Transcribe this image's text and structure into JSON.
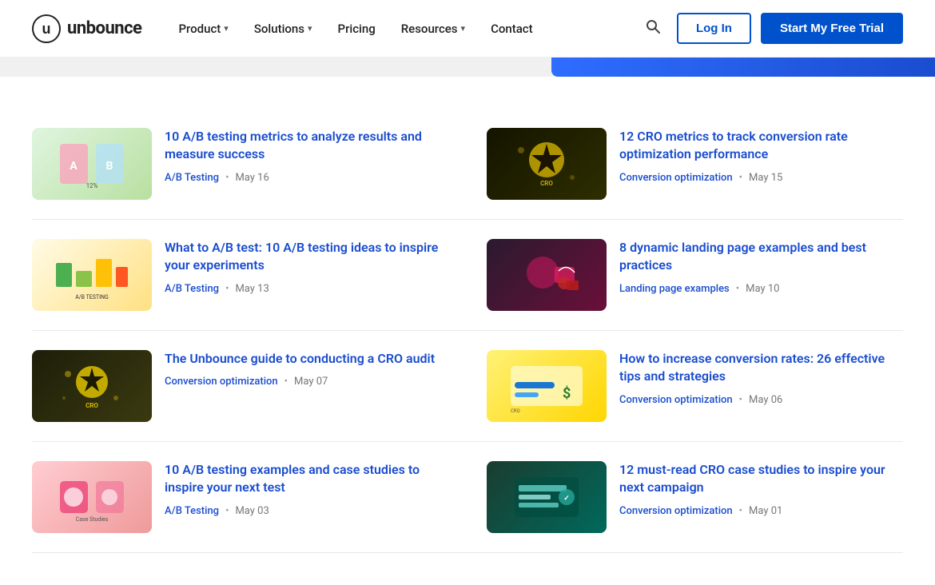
{
  "header": {
    "logo_text": "unbounce",
    "nav": [
      {
        "label": "Product",
        "has_dropdown": true
      },
      {
        "label": "Solutions",
        "has_dropdown": true
      },
      {
        "label": "Pricing",
        "has_dropdown": false
      },
      {
        "label": "Resources",
        "has_dropdown": true
      },
      {
        "label": "Contact",
        "has_dropdown": false
      }
    ],
    "login_label": "Log In",
    "trial_label": "Start My Free Trial"
  },
  "articles": [
    {
      "id": "ab-metrics",
      "title": "10 A/B testing metrics to analyze results and measure success",
      "category": "A/B Testing",
      "date": "May 16",
      "thumb_type": "ab-test-1",
      "col": "left"
    },
    {
      "id": "cro-metrics",
      "title": "12 CRO metrics to track conversion rate optimization performance",
      "category": "Conversion optimization",
      "date": "May 15",
      "thumb_type": "cro-metrics",
      "col": "right"
    },
    {
      "id": "ab-ideas",
      "title": "What to A/B test: 10 A/B testing ideas to inspire your experiments",
      "category": "A/B Testing",
      "date": "May 13",
      "thumb_type": "ab-test-2",
      "col": "left"
    },
    {
      "id": "landing-examples",
      "title": "8 dynamic landing page examples and best practices",
      "category": "Landing page examples",
      "date": "May 10",
      "thumb_type": "landing-page",
      "col": "right"
    },
    {
      "id": "cro-audit",
      "title": "The Unbounce guide to conducting a CRO audit",
      "category": "Conversion optimization",
      "date": "May 07",
      "thumb_type": "cro-guide",
      "col": "left"
    },
    {
      "id": "conversion-rates",
      "title": "How to increase conversion rates: 26 effective tips and strategies",
      "category": "Conversion optimization",
      "date": "May 06",
      "thumb_type": "conversion-rates",
      "col": "right"
    },
    {
      "id": "ab-examples",
      "title": "10 A/B testing examples and case studies to inspire your next test",
      "category": "A/B Testing",
      "date": "May 03",
      "thumb_type": "ab-test-3",
      "col": "left"
    },
    {
      "id": "cro-case",
      "title": "12 must-read CRO case studies to inspire your next campaign",
      "category": "Conversion optimization",
      "date": "May 01",
      "thumb_type": "cro-case",
      "col": "right"
    }
  ]
}
